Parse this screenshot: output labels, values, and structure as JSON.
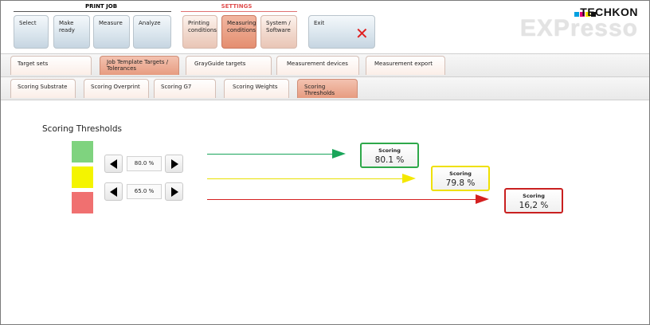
{
  "header": {
    "print_job_label": "PRINT JOB",
    "settings_label": "SETTINGS",
    "print_job_buttons": [
      "Select",
      "Make ready",
      "Measure",
      "Analyze"
    ],
    "settings_buttons": [
      "Printing conditions",
      "Measuring conditions",
      "System / Software"
    ],
    "exit_label": "Exit",
    "logo_brand": "TECHKON",
    "logo_product": "EXPresso"
  },
  "tabs_row1": [
    "Target sets",
    "Job Template Targets / Tolerances",
    "GrayGuide targets",
    "Measurement devices",
    "Measurement export"
  ],
  "tabs_row2": [
    "Scoring Substrate",
    "Scoring Overprint",
    "Scoring G7",
    "Scoring Weights",
    "Scoring Thresholds"
  ],
  "main": {
    "title": "Scoring Thresholds",
    "threshold_upper": "80.0 %",
    "threshold_lower": "65.0 %",
    "colors": {
      "green": "#7fd37f",
      "yellow": "#f4f400",
      "red": "#f07070"
    },
    "scores": [
      {
        "label": "Scoring",
        "value": "80.1 %"
      },
      {
        "label": "Scoring",
        "value": "79.8 %"
      },
      {
        "label": "Scoring",
        "value": "16,2 %"
      }
    ]
  }
}
